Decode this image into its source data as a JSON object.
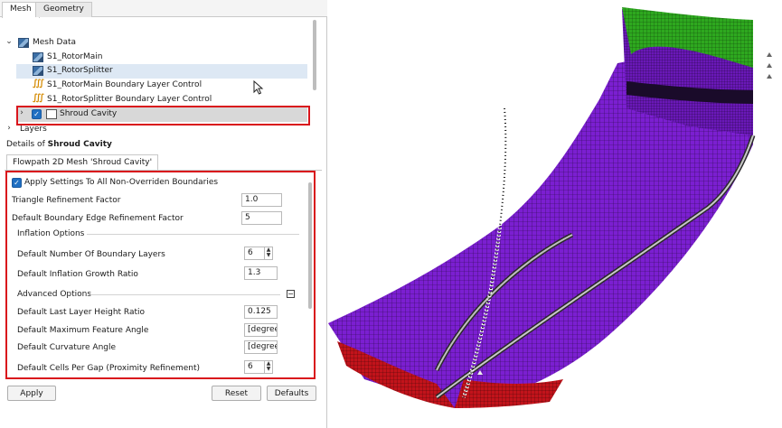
{
  "tabs": {
    "mesh": "Mesh",
    "geometry": "Geometry"
  },
  "tree": {
    "mesh_data": "Mesh Data",
    "rotor_main": "S1_RotorMain",
    "rotor_splitter": "S1_RotorSplitter",
    "rotor_main_bl": "S1_RotorMain Boundary Layer Control",
    "rotor_splitter_bl": "S1_RotorSplitter Boundary Layer Control",
    "shroud_cavity": "Shroud Cavity",
    "layers": "Layers"
  },
  "details": {
    "title_prefix": "Details of",
    "title_object": "Shroud Cavity",
    "subtab": "Flowpath 2D Mesh 'Shroud Cavity'",
    "apply_all_label": "Apply Settings To All Non-Overriden Boundaries",
    "triangle_label": "Triangle Refinement Factor",
    "triangle_value": "1.0",
    "edge_label": "Default Boundary Edge Refinement Factor",
    "edge_value": "5",
    "inflation_group": "Inflation Options",
    "num_layers_label": "Default Number Of Boundary Layers",
    "num_layers_value": "6",
    "growth_label": "Default Inflation Growth Ratio",
    "growth_value": "1.3",
    "advanced_group": "Advanced Options",
    "last_layer_label": "Default Last Layer Height Ratio",
    "last_layer_value": "0.125",
    "feature_angle_label": "Default Maximum Feature Angle",
    "feature_angle_value": "[degree]",
    "curvature_label": "Default Curvature Angle",
    "curvature_value": "[degree]",
    "cells_gap_label": "Default Cells Per Gap (Proximity Refinement)",
    "cells_gap_value": "6"
  },
  "buttons": {
    "apply": "Apply",
    "reset": "Reset",
    "defaults": "Defaults"
  },
  "colors": {
    "highlight_box": "#d9151c",
    "mesh_purple": "#7b1fd1",
    "mesh_green": "#2ea81f",
    "mesh_red": "#c2131b",
    "checkbox_blue": "#1f6fc2"
  }
}
